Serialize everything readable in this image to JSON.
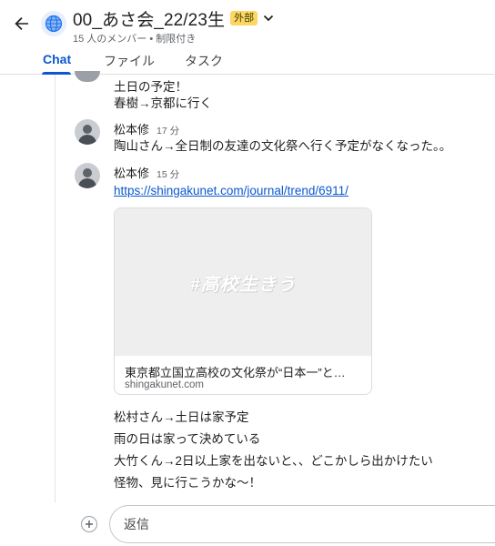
{
  "header": {
    "title": "00_あさ会_22/23生",
    "badge": "外部",
    "subtitle": "15 人のメンバー • 制限付き"
  },
  "tabs": [
    {
      "label": "Chat",
      "active": true
    },
    {
      "label": "ファイル",
      "active": false
    },
    {
      "label": "タスク",
      "active": false
    }
  ],
  "messages": {
    "first_block": {
      "line1": "土日の予定！",
      "line2": "春樹→京都に行く"
    },
    "msg2": {
      "sender": "松本修",
      "time": "17 分",
      "text": "陶山さん→全日制の友達の文化祭へ行く予定がなくなった。。"
    },
    "msg3": {
      "sender": "松本修",
      "time": "15 分",
      "link": "https://shingakunet.com/journal/trend/6911/",
      "card": {
        "image_text": "#高校生きう",
        "title": "東京都立国立高校の文化祭が“日本一”と…",
        "domain": "shingakunet.com"
      },
      "lines": [
        "松村さん→土日は家予定",
        "雨の日は家って決めている",
        "大竹くん→2日以上家を出ないと、、どこかしら出かけたい",
        "怪物、見に行こうかな〜！"
      ]
    }
  },
  "composer": {
    "placeholder": "返信"
  },
  "colors": {
    "accent": "#0b57d0",
    "badge": "#fdd663",
    "link": "#0b57d0"
  },
  "icons": {
    "back": "arrow-left-icon",
    "space": "globe-icon",
    "dropdown": "chevron-down-icon",
    "add": "plus-circle-icon"
  }
}
